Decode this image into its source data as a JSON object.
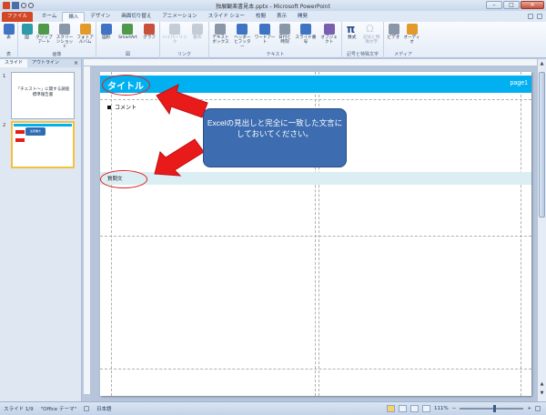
{
  "window": {
    "title": "独展観楽書見本.pptx - Microsoft PowerPoint",
    "minimize": "–",
    "maximize": "□",
    "close": "✕"
  },
  "ribbon_tabs": [
    {
      "label": "ファイル"
    },
    {
      "label": "ホーム"
    },
    {
      "label": "挿入"
    },
    {
      "label": "デザイン"
    },
    {
      "label": "画面切り替え"
    },
    {
      "label": "アニメーション"
    },
    {
      "label": "スライド ショー"
    },
    {
      "label": "校閲"
    },
    {
      "label": "表示"
    },
    {
      "label": "開発"
    }
  ],
  "ribbon_groups": {
    "table": {
      "label": "表",
      "buttons": [
        "表"
      ]
    },
    "images": {
      "label": "画像",
      "buttons": [
        "図",
        "クリップアート",
        "スクリーンショット",
        "フォトアルバム"
      ]
    },
    "illustrations": {
      "label": "図",
      "buttons": [
        "図形",
        "SmartArt",
        "グラフ"
      ]
    },
    "links": {
      "label": "リンク",
      "buttons": [
        "ハイパーリンク",
        "動作"
      ]
    },
    "text": {
      "label": "テキスト",
      "buttons": [
        "テキストボックス",
        "ヘッダーとフッター",
        "ワードアート",
        "日付と時刻",
        "スライド番号",
        "オブジェクト"
      ]
    },
    "symbols": {
      "label": "記号と特殊文字",
      "buttons": [
        "数式",
        "記号と特殊文字"
      ]
    },
    "media": {
      "label": "メディア",
      "buttons": [
        "ビデオ",
        "オーディオ"
      ]
    }
  },
  "left_panel": {
    "tabs": [
      "スライド",
      "アウトライン"
    ],
    "close": "×",
    "thumb1_num": "1",
    "thumb1_text": "「チェスト～」に関する調査\n標準報告書",
    "thumb2_num": "2",
    "thumb2_callout": "注意書き"
  },
  "slide": {
    "title": "タイトル",
    "page": "page1",
    "comment": "コメント",
    "question": "質問文",
    "callout": "Excelの見出しと完全に一致した文言にしておいてください。"
  },
  "status": {
    "slide": "スライド 1/9",
    "theme": "\"Office テーマ\"",
    "language": "日本語",
    "zoom": "111%"
  },
  "colors": {
    "title_bar": "#00b0f0",
    "callout": "#3d6db0",
    "annotation_red": "#e02020",
    "question_band": "#dbeef4"
  }
}
